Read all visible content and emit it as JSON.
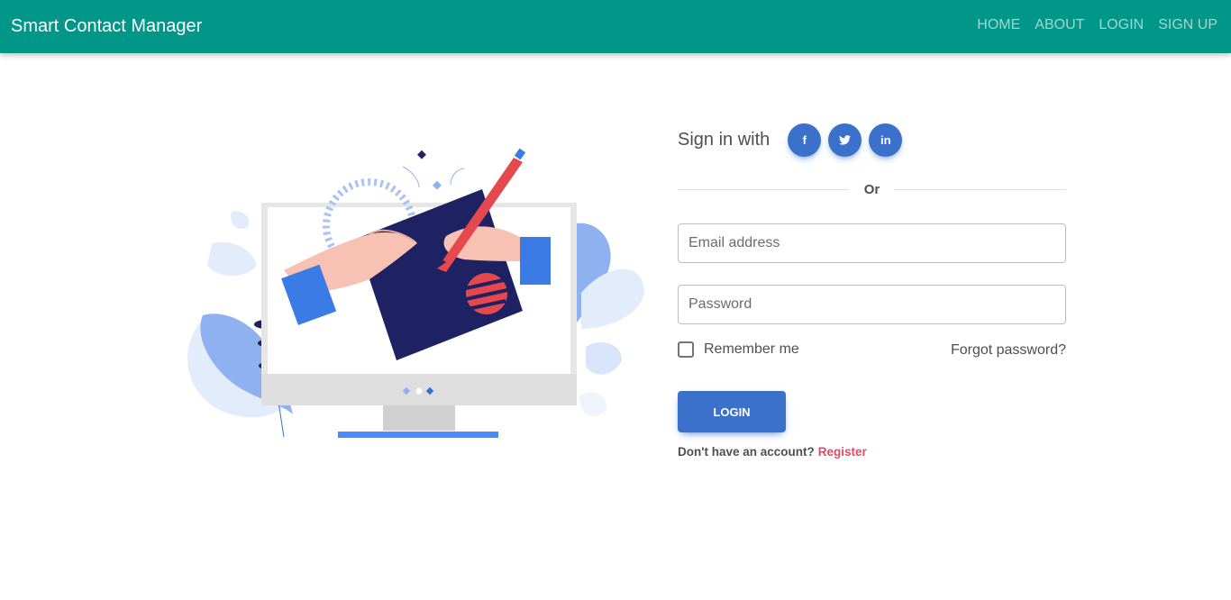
{
  "navbar": {
    "brand": "Smart Contact Manager",
    "links": [
      "HOME",
      "ABOUT",
      "LOGIN",
      "SIGN UP"
    ]
  },
  "signin": {
    "label": "Sign in with",
    "social": [
      {
        "icon": "facebook-icon",
        "glyph": "f"
      },
      {
        "icon": "twitter-icon",
        "glyph": "t"
      },
      {
        "icon": "linkedin-icon",
        "glyph": "in"
      }
    ]
  },
  "divider": {
    "text": "Or"
  },
  "form": {
    "email_placeholder": "Email address",
    "password_placeholder": "Password",
    "remember_label": "Remember me",
    "forgot_label": "Forgot password?",
    "login_label": "LOGIN",
    "no_account_text": "Don't have an account?",
    "register_label": "Register"
  },
  "colors": {
    "navbar": "#009688",
    "primary": "#3b71ca",
    "danger": "#dc4c64"
  }
}
